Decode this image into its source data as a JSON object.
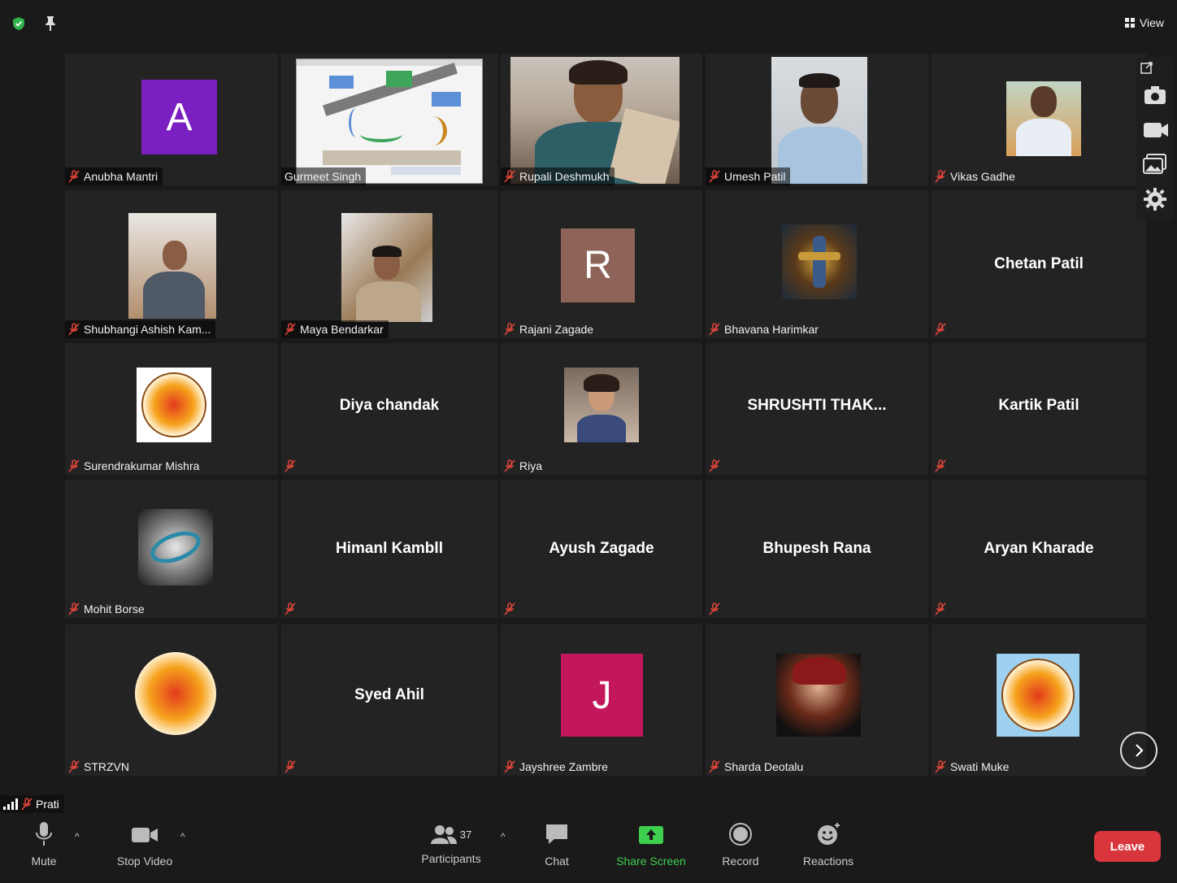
{
  "topbar": {
    "view_label": "View"
  },
  "participants": [
    {
      "name": "Anubha Mantri",
      "avatar_letter": "A",
      "avatar_color": "#7a1fc1"
    },
    {
      "name": "Gurmeet Singh"
    },
    {
      "name": "Rupali Deshmukh"
    },
    {
      "name": "Umesh Patil"
    },
    {
      "name": "Vikas Gadhe"
    },
    {
      "name": "Shubhangi Ashish Kam..."
    },
    {
      "name": "Maya Bendarkar"
    },
    {
      "name": "Rajani Zagade",
      "avatar_letter": "R",
      "avatar_color": "#8d6457"
    },
    {
      "name": "Bhavana Harimkar"
    },
    {
      "name": "Chetan Patil"
    },
    {
      "name": "Surendrakumar Mishra"
    },
    {
      "name": "Diya chandak"
    },
    {
      "name": "Riya"
    },
    {
      "name": "SHRUSHTI  THAK..."
    },
    {
      "name": "Kartik Patil"
    },
    {
      "name": "Mohit Borse"
    },
    {
      "name": "Himanl Kambll"
    },
    {
      "name": "Ayush Zagade"
    },
    {
      "name": "Bhupesh Rana"
    },
    {
      "name": "Aryan Kharade"
    },
    {
      "name": "STRZVN"
    },
    {
      "name": "Syed Ahil"
    },
    {
      "name": "Jayshree Zambre",
      "avatar_letter": "J",
      "avatar_color": "#c2185b"
    },
    {
      "name": "Sharda Deotalu"
    },
    {
      "name": "Swati Muke"
    }
  ],
  "self": {
    "name": "Prati"
  },
  "toolbar": {
    "mute": "Mute",
    "stop_video": "Stop Video",
    "participants": "Participants",
    "participants_count": "37",
    "chat": "Chat",
    "share_screen": "Share Screen",
    "record": "Record",
    "reactions": "Reactions",
    "leave": "Leave"
  },
  "colors": {
    "share_green": "#3ecf4f",
    "leave_red": "#d8363c",
    "muted_red": "#e0453a"
  }
}
